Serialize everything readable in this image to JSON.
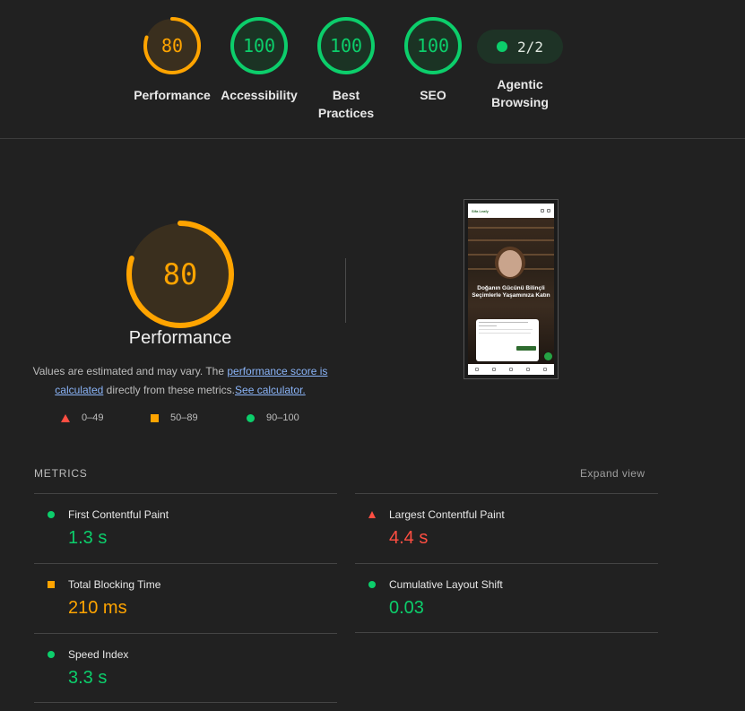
{
  "colors": {
    "pass": "#0cce6b",
    "average": "#ffa400",
    "fail": "#ff4e42"
  },
  "categories": [
    {
      "label": "Performance",
      "score": "80",
      "rating": "average"
    },
    {
      "label": "Accessibility",
      "score": "100",
      "rating": "pass"
    },
    {
      "label": "Best Practices",
      "score": "100",
      "rating": "pass"
    },
    {
      "label": "SEO",
      "score": "100",
      "rating": "pass"
    }
  ],
  "agentic": {
    "value": "2/2",
    "label": "Agentic Browsing"
  },
  "performance": {
    "score": "80",
    "title": "Performance",
    "desc_pre": "Values are estimated and may vary. The ",
    "desc_link1": "performance score is calculated",
    "desc_mid": " directly from these metrics.",
    "desc_link2": "See calculator."
  },
  "legend": {
    "fail": "0–49",
    "average": "50–89",
    "pass": "90–100"
  },
  "screenshot": {
    "brand": "Sifa Leafy",
    "headline": "Doğanın Gücünü Bilinçli Seçimlerle Yaşamınıza Katın"
  },
  "metrics": {
    "header": "METRICS",
    "expand_label": "Expand view",
    "items": [
      {
        "name": "First Contentful Paint",
        "value": "1.3 s",
        "rating": "pass"
      },
      {
        "name": "Largest Contentful Paint",
        "value": "4.4 s",
        "rating": "fail"
      },
      {
        "name": "Total Blocking Time",
        "value": "210 ms",
        "rating": "average"
      },
      {
        "name": "Cumulative Layout Shift",
        "value": "0.03",
        "rating": "pass"
      },
      {
        "name": "Speed Index",
        "value": "3.3 s",
        "rating": "pass"
      }
    ]
  }
}
